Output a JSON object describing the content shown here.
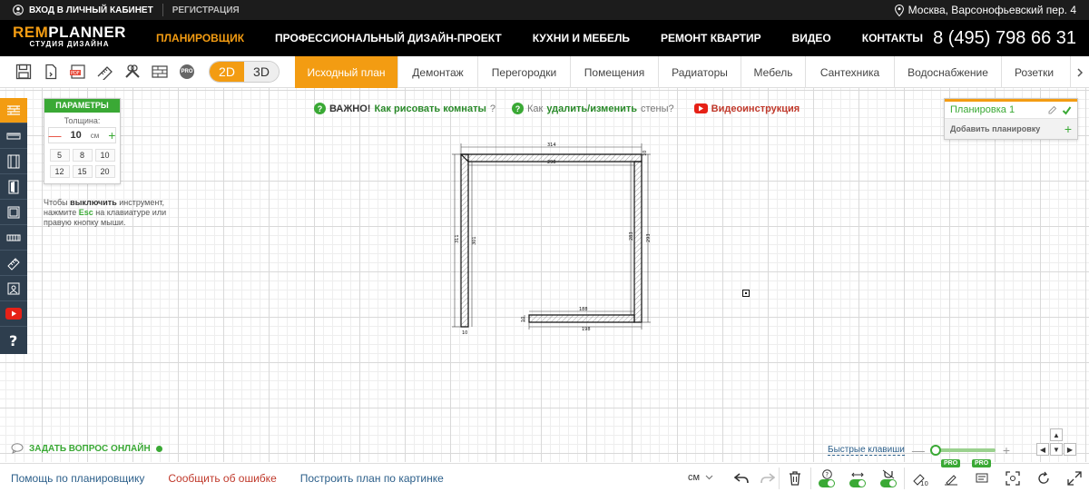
{
  "topbar": {
    "login": "ВХОД В ЛИЧНЫЙ КАБИНЕТ",
    "register": "РЕГИСТРАЦИЯ",
    "address": "Москва, Варсонофьевский пер. 4"
  },
  "logo": {
    "line1_a": "REM",
    "line1_b": "PLANNER",
    "line2": "СТУДИЯ ДИЗАЙНА"
  },
  "nav": {
    "items": [
      "ПЛАНИРОВЩИК",
      "ПРОФЕССИОНАЛЬНЫЙ ДИЗАЙН-ПРОЕКТ",
      "КУХНИ И МЕБЕЛЬ",
      "РЕМОНТ КВАРТИР",
      "ВИДЕО",
      "КОНТАКТЫ"
    ],
    "active": "ПЛАНИРОВЩИК",
    "phone": "8 (495) 798 66 31"
  },
  "toolbar": {
    "mode_2d": "2D",
    "mode_3d": "3D",
    "pro_badge": "PRO",
    "tabs": [
      "Исходный план",
      "Демонтаж",
      "Перегородки",
      "Помещения",
      "Радиаторы",
      "Мебель",
      "Сантехника",
      "Водоснабжение",
      "Розетки"
    ],
    "active_tab": "Исходный план",
    "more_icon": "chevron-right-icon"
  },
  "params": {
    "title": "ПАРАМЕТРЫ",
    "thickness_label": "Толщина:",
    "thickness_value": "10",
    "unit": "см",
    "minus": "—",
    "plus": "+",
    "presets": [
      "5",
      "8",
      "10",
      "12",
      "15",
      "20"
    ]
  },
  "hint": {
    "part1": "Чтобы ",
    "bold": "выключить",
    "part2": " инструмент, нажмите ",
    "esc": "Esc",
    "part3": " на клавиатуре или правую кнопку мыши."
  },
  "help": {
    "important": "ВАЖНО!",
    "how_draw": "Как рисовать комнаты",
    "q1": "?",
    "how": "Как",
    "delete_change": "удалить/изменить",
    "walls": "стены?",
    "video": "Видеоинструкция"
  },
  "layouts": {
    "current": "Планировка 1",
    "add": "Добавить планировку",
    "add_plus": "+"
  },
  "plan": {
    "dims": {
      "top_outer": "314",
      "top_inner": "298",
      "top_right_small": "10",
      "left_outer": "311",
      "left_inner": "301",
      "right_inner": "283",
      "right_outer": "293",
      "bottom_inner": "188",
      "bottom_outer": "198",
      "bottom_small": "10",
      "left_bottom_small": "10"
    }
  },
  "status": {
    "ask_online": "ЗАДАТЬ ВОПРОС ОНЛАЙН",
    "hotkeys": "Быстрые клавиши",
    "zoom_minus": "—",
    "zoom_plus": "+",
    "zoom_level": 0
  },
  "bottom": {
    "help_link": "Помощь по планировщику",
    "report": "Сообщить об ошибке",
    "build": "Построить план по картинке",
    "unit": "см",
    "pro1": "PRO",
    "pro2": "PRO",
    "thickness_icon_value": "10"
  },
  "colors": {
    "accent": "#f39c12",
    "green": "#3aa935",
    "dark": "#1c1c1c",
    "side": "#2e3e4e"
  }
}
